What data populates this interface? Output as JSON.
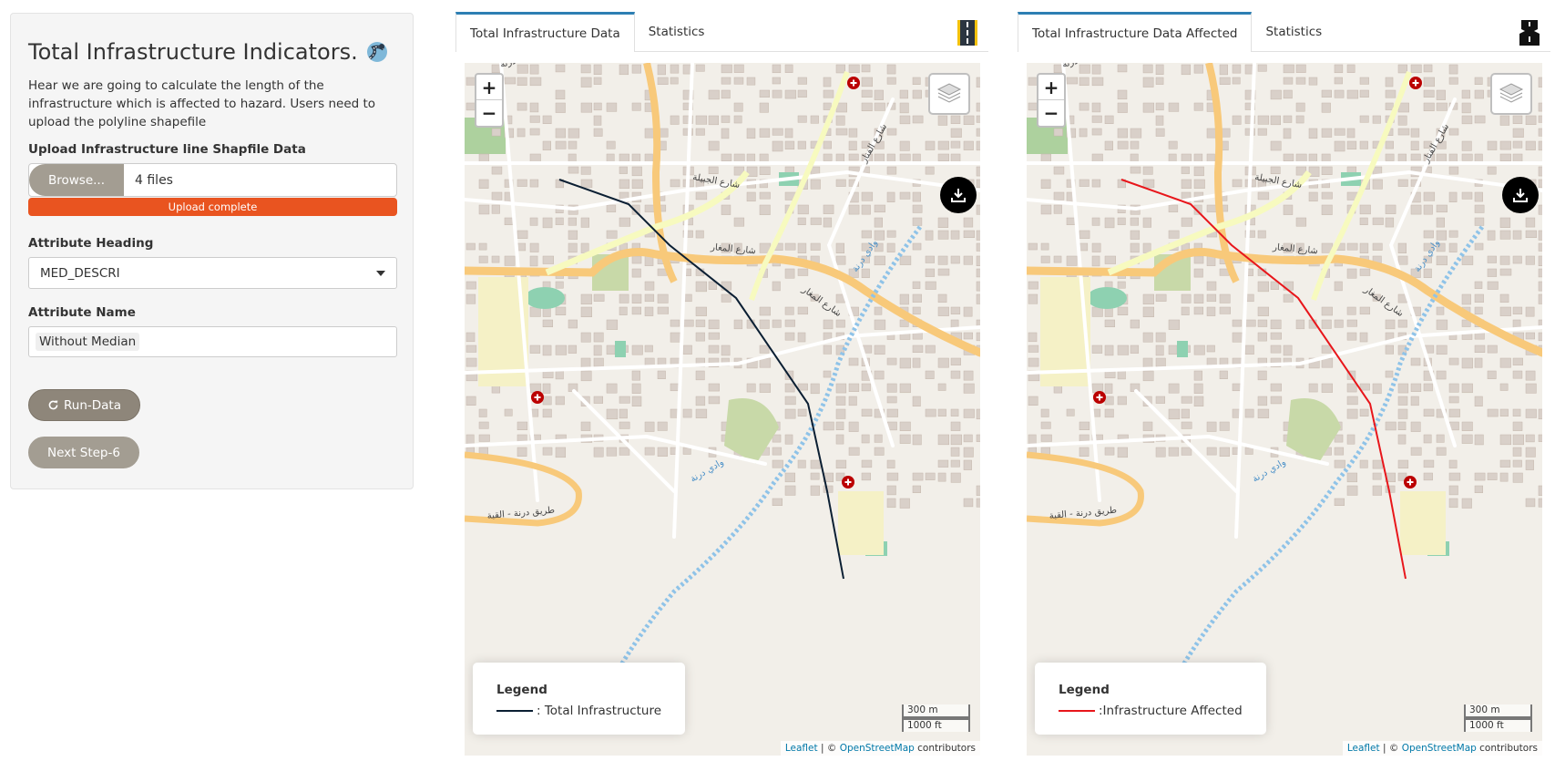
{
  "sidebar": {
    "title": "Total Infrastructure Indicators.",
    "description": "Hear we are going to calculate the length of the infrastructure which is affected to hazard. Users need to upload the polyline shapefile",
    "upload_label": "Upload Infrastructure line Shapfile Data",
    "browse_label": "Browse...",
    "file_status": "4 files",
    "progress_text": "Upload complete",
    "progress_value": 1.0,
    "attr_heading_label": "Attribute Heading",
    "attr_heading_value": "MED_DESCRI",
    "attr_name_label": "Attribute Name",
    "attr_name_value": "Without Median",
    "run_label": "Run-Data",
    "next_label": "Next Step-6"
  },
  "panels": {
    "left": {
      "tabs": [
        "Total Infrastructure Data",
        "Statistics"
      ],
      "active_tab": 0,
      "icon": "road-icon",
      "legend_title": "Legend",
      "legend_label": ": Total Infrastructure",
      "line_color": "#0b1f33"
    },
    "right": {
      "tabs": [
        "Total Infrastructure Data Affected",
        "Statistics"
      ],
      "active_tab": 0,
      "icon": "broken-road-icon",
      "legend_title": "Legend",
      "legend_label": ":Infrastructure Affected",
      "line_color": "#e8161b"
    }
  },
  "map": {
    "zoom_in": "+",
    "zoom_out": "−",
    "scale_m": "300 m",
    "scale_ft": "1000 ft",
    "attribution_leaflet": "Leaflet",
    "attribution_sep": " | © ",
    "attribution_osm": "OpenStreetMap",
    "attribution_tail": " contributors",
    "street_labels": [
      "شارع الجبيلة",
      "شارع المغار",
      "شارع المغار",
      "وادي درنة",
      "وادي درنة",
      "طريق درنة - القبة",
      "شارع الفنار",
      "طريق البيضاء-درنة"
    ]
  },
  "colors": {
    "accent": "#e95420",
    "button": "#a39d92",
    "tab_accent": "#2d7fb3"
  }
}
